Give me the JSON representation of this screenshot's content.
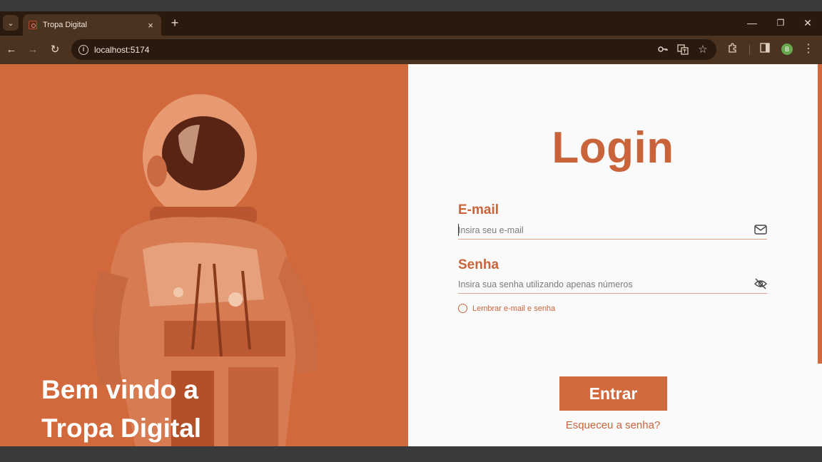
{
  "browser": {
    "tab_title": "Tropa Digital",
    "tab_close": "×",
    "new_tab": "+",
    "url": "localhost:5174",
    "profile_initial": "B",
    "window_controls": {
      "minimize": "—",
      "restore": "❐",
      "close": "✕"
    },
    "icons": [
      "tab-list-icon",
      "back-icon",
      "forward-icon",
      "reload-icon",
      "info-icon",
      "key-icon",
      "translate-icon",
      "star-icon",
      "extensions-icon",
      "side-panel-icon",
      "menu-icon"
    ]
  },
  "hero": {
    "welcome_text": "Bem vindo a\nTropa Digital",
    "background_color": "#d2693c"
  },
  "login": {
    "title": "Login",
    "email": {
      "label": "E-mail",
      "placeholder": "Insira seu e-mail",
      "icon": "mail-icon"
    },
    "password": {
      "label": "Senha",
      "placeholder": "Insira sua senha utilizando apenas números",
      "icon": "eye-off-icon"
    },
    "remember_label": "Lembrar e-mail e senha",
    "submit_label": "Entrar",
    "forgot_label": "Esqueceu a senha?",
    "accent_color": "#c9643a"
  }
}
